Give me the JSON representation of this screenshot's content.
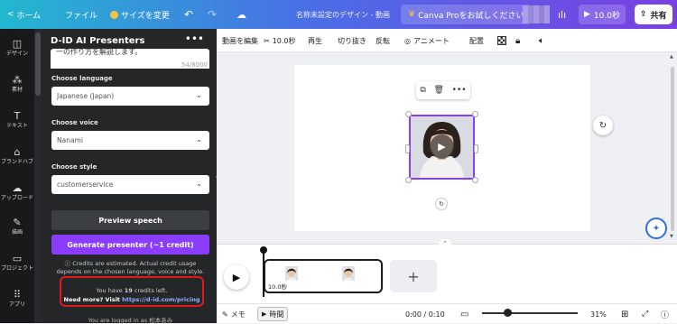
{
  "topbar": {
    "home": "ホーム",
    "file": "ファイル",
    "resize": "サイズを変更",
    "doc_title": "名称未設定のデザイン - 動画",
    "upgrade": "Canva Proをお試しください",
    "play_duration": "10.0秒",
    "share": "共有"
  },
  "rail": {
    "items": [
      {
        "label": "デザイン",
        "icon": "layout-icon"
      },
      {
        "label": "素材",
        "icon": "elements-icon"
      },
      {
        "label": "テキスト",
        "icon": "text-icon"
      },
      {
        "label": "ブランドハブ",
        "icon": "brand-icon"
      },
      {
        "label": "アップロード",
        "icon": "upload-icon"
      },
      {
        "label": "描画",
        "icon": "draw-icon"
      },
      {
        "label": "プロジェクト",
        "icon": "folder-icon"
      },
      {
        "label": "アプリ",
        "icon": "apps-icon"
      }
    ]
  },
  "panel": {
    "title": "D-ID AI Presenters",
    "script_text": "一の作り方を解説します。",
    "char_count": "54/8000",
    "language_label": "Choose language",
    "language_value": "Japanese (Japan)",
    "voice_label": "Choose voice",
    "voice_value": "Nanami",
    "style_label": "Choose style",
    "style_value": "customerservice",
    "preview_button": "Preview speech",
    "generate_button": "Generate presenter (~1 credit)",
    "note": "ⓘ Credits are estimated. Actual credit usage depends on the chosen language, voice and style.",
    "credits_prefix": "You have ",
    "credits_count": "19",
    "credits_suffix": " credits left.",
    "need_more": "Need more? Visit ",
    "pricing_link": "https://d-id.com/pricing",
    "logged_in": "You are logged in as 松本あみ"
  },
  "editor_toolbar": {
    "edit_video": "動画を編集",
    "trim_duration": "10.0秒",
    "playback": "再生",
    "crop": "切り抜き",
    "flip": "反転",
    "animate": "アニメート",
    "position": "配置"
  },
  "timeline": {
    "clip_duration": "10.0秒"
  },
  "bottombar": {
    "notes": "メモ",
    "timing": "時間",
    "time": "0:00 / 0:10",
    "zoom": "31%"
  },
  "colors": {
    "accent": "#8b3dff",
    "highlight_box": "#e0191c"
  }
}
